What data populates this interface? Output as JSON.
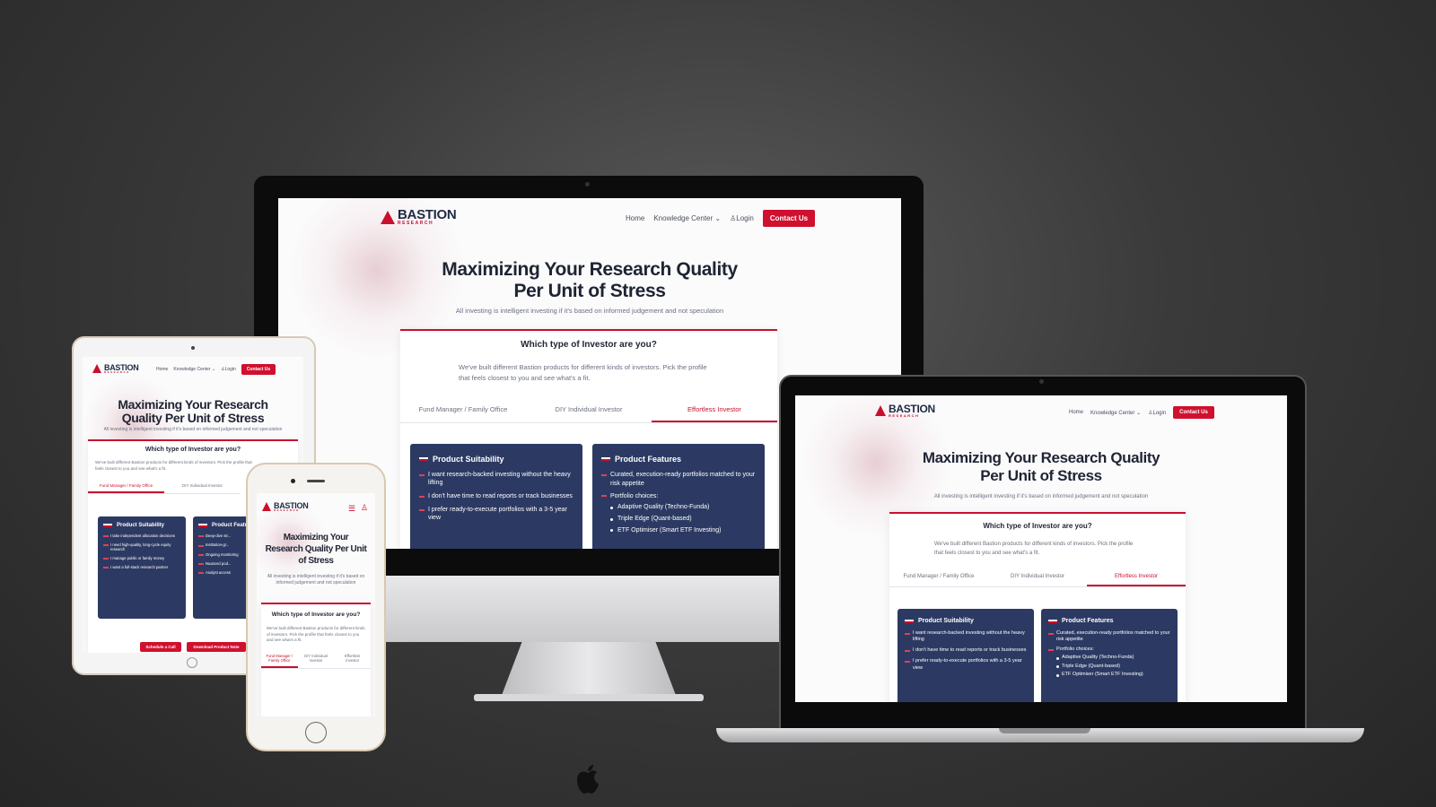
{
  "brand": {
    "name": "BASTION",
    "tagline": "RESEARCH",
    "accent": "#c8102e",
    "navy": "#2c3a63"
  },
  "nav": {
    "home": "Home",
    "knowledge": "Knowledge Center",
    "login": "Login",
    "contact": "Contact Us"
  },
  "hero": {
    "title": "Maximizing Your Research Quality Per Unit of Stress",
    "subtitle": "All investing is intelligent investing if it's based on informed judgement and not speculation"
  },
  "investor": {
    "question": "Which type of Investor are you?",
    "intro": "We've built different Bastion products for different kinds of investors. Pick the profile that feels closest to you and see what's a fit.",
    "tabs": [
      "Fund Manager / Family Office",
      "DIY Individual Investor",
      "Effortless Investor"
    ]
  },
  "suitability": {
    "title": "Product Suitability",
    "items": [
      "I want research-backed investing without the heavy lifting",
      "I don't have time to read reports or track businesses",
      "I prefer ready-to-execute portfolios with a 3-5 year view"
    ]
  },
  "features": {
    "title": "Product Features",
    "items": [
      "Curated, execution-ready portfolios matched to your risk appetite",
      "Portfolio choices:"
    ],
    "choices": [
      "Adaptive Quality (Techno-Funda)",
      "Triple Edge (Quant-based)",
      "ETF Optimiser (Smart ETF Investing)"
    ]
  },
  "tablet": {
    "suitability_items": [
      "I take independent allocation decisions",
      "I need high-quality, long-cycle equity research",
      "I manage public or family money",
      "I want a full-stack research partner"
    ],
    "features_partial": [
      "Deep-dive str...",
      "Institution-gr...",
      "Ongoing monitoring",
      "Nuanced pod...",
      "Analyst access"
    ],
    "cta": [
      "Schedule a Call",
      "Download Product Note"
    ]
  }
}
